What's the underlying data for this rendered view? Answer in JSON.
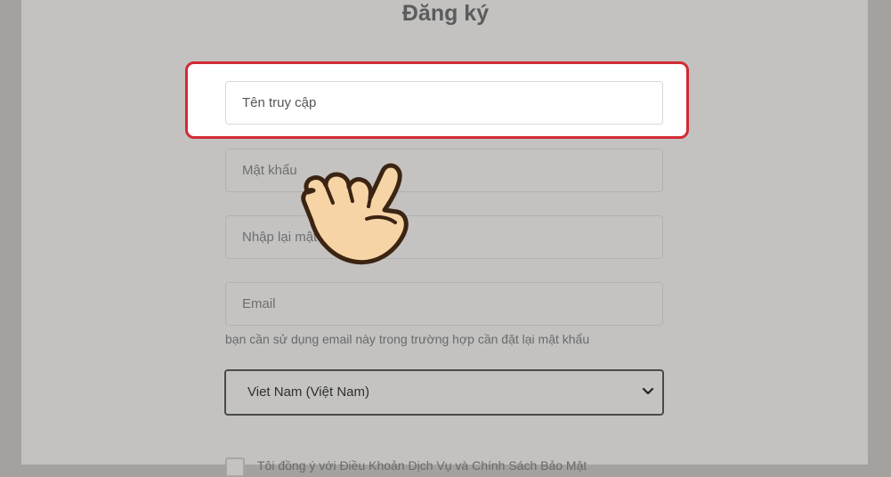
{
  "form": {
    "title": "Đăng ký",
    "username_placeholder": "Tên truy cập",
    "password_placeholder": "Mật khẩu",
    "confirm_password_placeholder": "Nhập lại mật khẩu",
    "email_placeholder": "Email",
    "email_hint": "bạn cần sử dụng email này trong trường hợp cần đặt lại mật khẩu",
    "country_selected": "Viet Nam (Việt Nam)",
    "terms_label": "Tôi đồng ý với Điều Khoản Dịch Vụ và Chính Sách Bảo Mật"
  },
  "overlay": {
    "highlight_color": "#d32a35",
    "hand_icon": "pointing-hand-icon"
  },
  "icons": {
    "select_chevron": "chevron-down-icon"
  }
}
